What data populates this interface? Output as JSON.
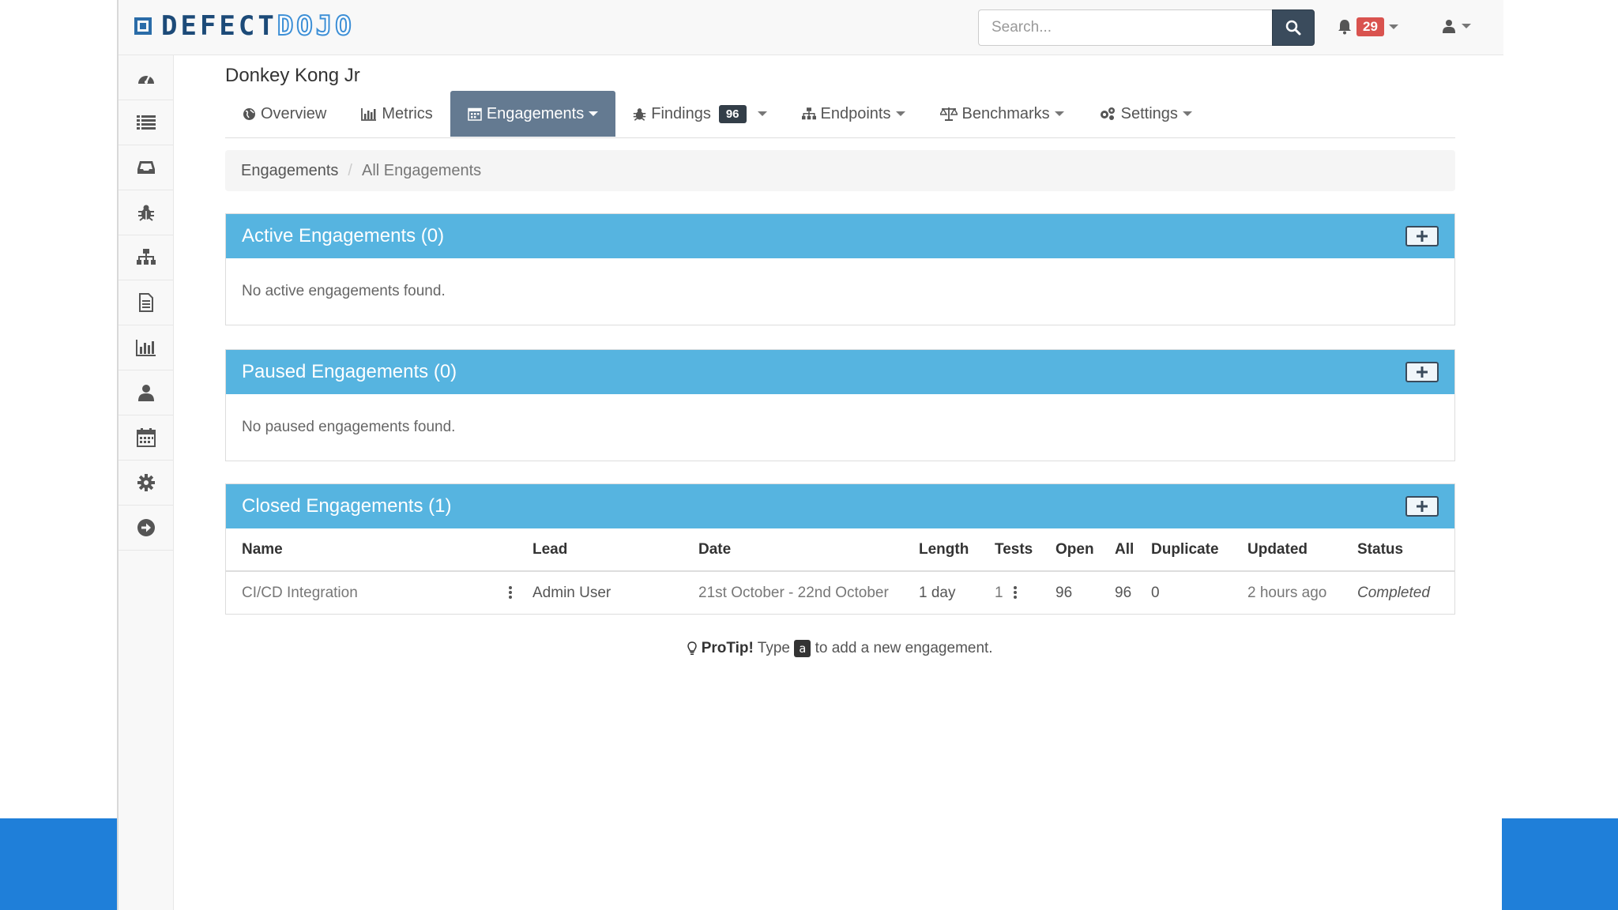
{
  "app": {
    "logo_part1": "DEFECT",
    "logo_part2": "DOJO"
  },
  "search": {
    "placeholder": "Search..."
  },
  "notifications": {
    "count": "29"
  },
  "product": {
    "title": "Donkey Kong Jr"
  },
  "tabs": [
    {
      "label": "Overview"
    },
    {
      "label": "Metrics"
    },
    {
      "label": "Engagements"
    },
    {
      "label": "Findings",
      "badge": "96"
    },
    {
      "label": "Endpoints"
    },
    {
      "label": "Benchmarks"
    },
    {
      "label": "Settings"
    }
  ],
  "breadcrumb": {
    "root": "Engagements",
    "current": "All Engagements"
  },
  "active_panel": {
    "title": "Active Engagements (0)",
    "empty": "No active engagements found."
  },
  "paused_panel": {
    "title": "Paused Engagements (0)",
    "empty": "No paused engagements found."
  },
  "closed_panel": {
    "title": "Closed Engagements (1)",
    "columns": [
      "Name",
      "Lead",
      "Date",
      "Length",
      "Tests",
      "Open",
      "All",
      "Duplicate",
      "Updated",
      "Status"
    ],
    "rows": [
      {
        "name": "CI/CD Integration",
        "lead": "Admin User",
        "date": "21st October - 22nd October",
        "length": "1 day",
        "tests": "1",
        "open": "96",
        "all": "96",
        "duplicate": "0",
        "updated": "2 hours ago",
        "status": "Completed"
      }
    ]
  },
  "protip": {
    "label": "ProTip!",
    "before": "Type",
    "key": "a",
    "after": "to add a new engagement."
  },
  "colors": {
    "panel_header": "#56b4e0",
    "active_tab": "#647a91",
    "badge_red": "#d9534f",
    "page_side_blue": "#1f7fd9"
  }
}
